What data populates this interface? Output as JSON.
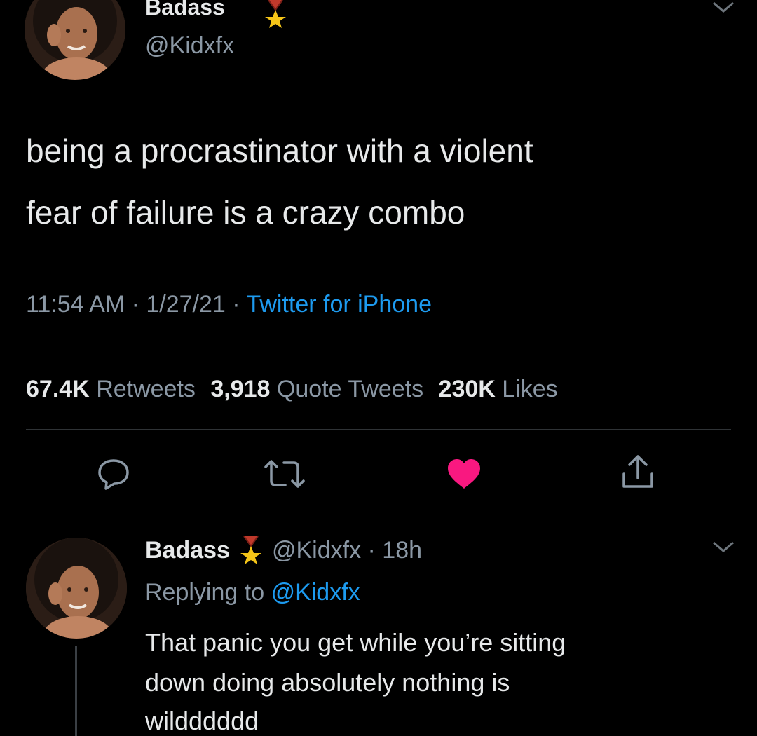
{
  "tweet": {
    "display_name": "Badass",
    "badge_icon": "medal-icon",
    "handle": "@Kidxfx",
    "text_line1": "being a procrastinator with a violent",
    "text_line2": "fear of failure is a crazy combo",
    "time": "11:54 AM",
    "sep1": " · ",
    "date": "1/27/21",
    "sep2": " · ",
    "source": "Twitter for iPhone",
    "stats": {
      "retweets_count": "67.4K",
      "retweets_label": "Retweets",
      "quotes_count": "3,918",
      "quotes_label": "Quote Tweets",
      "likes_count": "230K",
      "likes_label": "Likes"
    },
    "actions": [
      "reply-icon",
      "retweet-icon",
      "like-icon",
      "share-icon"
    ],
    "like_color": "#f91880"
  },
  "reply": {
    "display_name": "Badass",
    "badge_icon": "medal-icon",
    "handle_time": "@Kidxfx · 18h",
    "replying_prefix": "Replying to",
    "replying_handle": "@Kidxfx",
    "text_line1": "That panic you get while you’re sitting",
    "text_line2": "down doing absolutely nothing is",
    "text_line3": "wildddddd"
  },
  "colors": {
    "background": "#000000",
    "text": "#e7e9ea",
    "muted": "#8b98a5",
    "link": "#1d9bf0"
  }
}
